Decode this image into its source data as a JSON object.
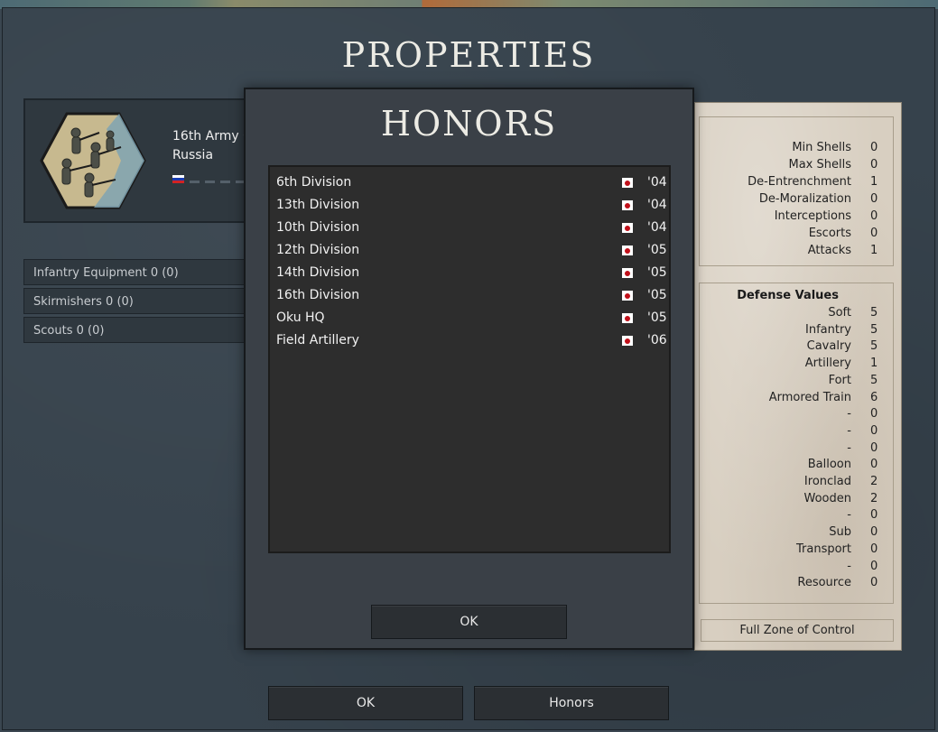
{
  "properties": {
    "title": "PROPERTIES",
    "unit": {
      "name": "16th Army C",
      "nation": "Russia",
      "flag_colors": [
        "#ffffff",
        "#1a3bb0",
        "#d22323"
      ]
    },
    "equipment": [
      {
        "label": "Infantry Equipment 0 (0)"
      },
      {
        "label": "Skirmishers 0 (0)"
      },
      {
        "label": "Scouts 0 (0)"
      }
    ],
    "attack_stats": [
      {
        "label": "Min Shells",
        "value": "0"
      },
      {
        "label": "Max Shells",
        "value": "0"
      },
      {
        "label": "De-Entrenchment",
        "value": "1"
      },
      {
        "label": "De-Moralization",
        "value": "0"
      },
      {
        "label": "Interceptions",
        "value": "0"
      },
      {
        "label": "Escorts",
        "value": "0"
      },
      {
        "label": "Attacks",
        "value": "1"
      }
    ],
    "defense": {
      "title": "Defense Values",
      "rows": [
        {
          "label": "Soft",
          "value": "5"
        },
        {
          "label": "Infantry",
          "value": "5"
        },
        {
          "label": "Cavalry",
          "value": "5"
        },
        {
          "label": "Artillery",
          "value": "1"
        },
        {
          "label": "Fort",
          "value": "5"
        },
        {
          "label": "Armored Train",
          "value": "6"
        },
        {
          "label": "-",
          "value": "0"
        },
        {
          "label": "-",
          "value": "0"
        },
        {
          "label": "-",
          "value": "0"
        },
        {
          "label": "Balloon",
          "value": "0"
        },
        {
          "label": "Ironclad",
          "value": "2"
        },
        {
          "label": "Wooden",
          "value": "2"
        },
        {
          "label": "-",
          "value": "0"
        },
        {
          "label": "Sub",
          "value": "0"
        },
        {
          "label": "Transport",
          "value": "0"
        },
        {
          "label": "-",
          "value": "0"
        },
        {
          "label": "Resource",
          "value": "0"
        }
      ]
    },
    "zone_of_control": "Full Zone of Control",
    "buttons": {
      "ok": "OK",
      "honors": "Honors"
    }
  },
  "honors_dialog": {
    "title": "HONORS",
    "flag_colors": {
      "field": "#ffffff",
      "disc": "#c0101a"
    },
    "items": [
      {
        "name": "6th Division",
        "year": "'04"
      },
      {
        "name": "13th Division",
        "year": "'04"
      },
      {
        "name": "10th Division",
        "year": "'04"
      },
      {
        "name": "12th Division",
        "year": "'05"
      },
      {
        "name": "14th Division",
        "year": "'05"
      },
      {
        "name": "16th Division",
        "year": "'05"
      },
      {
        "name": "Oku HQ",
        "year": "'05"
      },
      {
        "name": "Field Artillery",
        "year": "'06"
      }
    ],
    "ok_label": "OK"
  }
}
